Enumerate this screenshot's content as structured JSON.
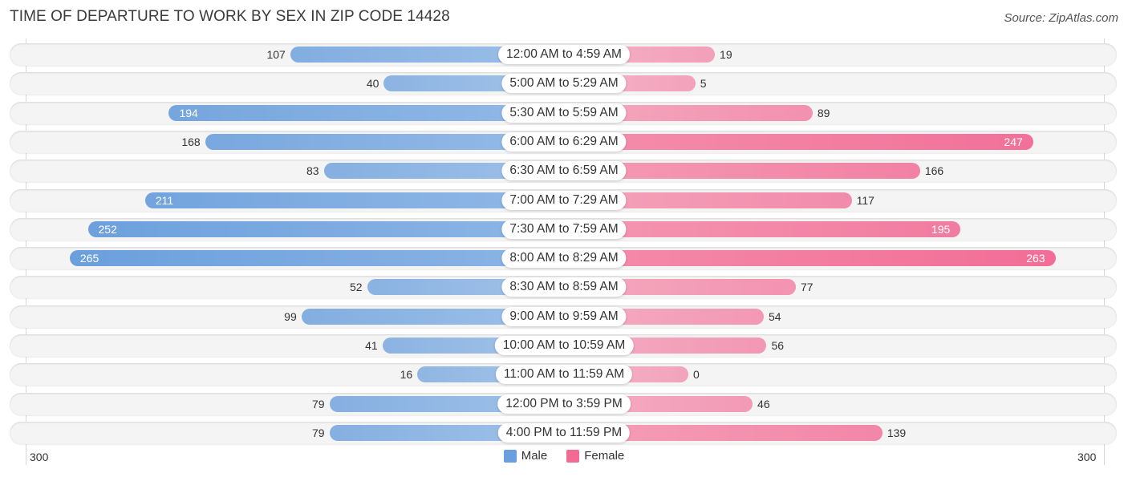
{
  "header": {
    "title": "TIME OF DEPARTURE TO WORK BY SEX IN ZIP CODE 14428",
    "source": "Source: ZipAtlas.com"
  },
  "colors": {
    "male": "#6a9fde",
    "female": "#f26b95"
  },
  "chart_data": {
    "type": "bar",
    "orientation": "horizontal-diverging",
    "title": "TIME OF DEPARTURE TO WORK BY SEX IN ZIP CODE 14428",
    "categories": [
      "12:00 AM to 4:59 AM",
      "5:00 AM to 5:29 AM",
      "5:30 AM to 5:59 AM",
      "6:00 AM to 6:29 AM",
      "6:30 AM to 6:59 AM",
      "7:00 AM to 7:29 AM",
      "7:30 AM to 7:59 AM",
      "8:00 AM to 8:29 AM",
      "8:30 AM to 8:59 AM",
      "9:00 AM to 9:59 AM",
      "10:00 AM to 10:59 AM",
      "11:00 AM to 11:59 AM",
      "12:00 PM to 3:59 PM",
      "4:00 PM to 11:59 PM"
    ],
    "series": [
      {
        "name": "Male",
        "side": "left",
        "values": [
          107,
          40,
          194,
          168,
          83,
          211,
          252,
          265,
          52,
          99,
          41,
          16,
          79,
          79
        ]
      },
      {
        "name": "Female",
        "side": "right",
        "values": [
          19,
          5,
          89,
          247,
          166,
          117,
          195,
          263,
          77,
          54,
          56,
          0,
          46,
          139
        ]
      }
    ],
    "axis": {
      "min_label": "300",
      "max_label": "300",
      "range": [
        -300,
        300
      ]
    },
    "legend": {
      "position": "bottom-center",
      "entries": [
        "Male",
        "Female"
      ]
    },
    "xlabel": "",
    "ylabel": ""
  }
}
